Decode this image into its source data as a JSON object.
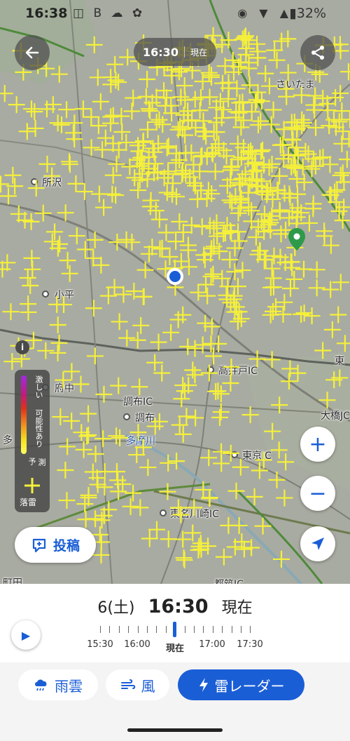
{
  "status_bar": {
    "time": "16:38",
    "left_icons": "◫ B ☁ ✿",
    "right_icons": "◉ ▼ ▲",
    "battery": "▮32%"
  },
  "header": {
    "time": "16:30",
    "now_label": "現在"
  },
  "map": {
    "places": [
      {
        "name": "所沢"
      },
      {
        "name": "小平"
      },
      {
        "name": "府中"
      },
      {
        "name": "調布"
      },
      {
        "name": "調布IC"
      },
      {
        "name": "多摩川"
      },
      {
        "name": "高井戸IC"
      },
      {
        "name": "東名川崎IC"
      },
      {
        "name": "東京IC"
      },
      {
        "name": "大橋JCT"
      },
      {
        "name": "多"
      },
      {
        "name": "さいたま"
      },
      {
        "name": "町田"
      },
      {
        "name": "都筑IC"
      },
      {
        "name": "東"
      }
    ]
  },
  "legend": {
    "heavy": "激しい",
    "possible": "可能性あり",
    "forecast": "予",
    "forecast2": "測",
    "lightning": "落雷",
    "info_icon": "i"
  },
  "buttons": {
    "post": "投稿",
    "zoom_in": "+",
    "zoom_out": "−"
  },
  "timeline": {
    "date": "6(土)",
    "time": "16:30",
    "now": "現在",
    "labels": [
      "15:30",
      "16:00",
      "現在",
      "17:00",
      "17:30"
    ]
  },
  "tabs": {
    "rain": "雨雲",
    "wind": "風",
    "thunder": "雷レーダー"
  },
  "colors": {
    "accent": "#1a5ed6",
    "lightning": "#f5f03a",
    "map_bg": "#a8aba1"
  }
}
